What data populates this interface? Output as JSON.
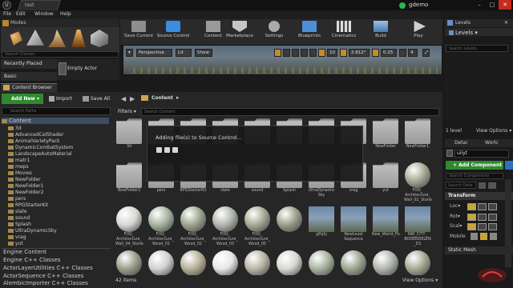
{
  "window": {
    "tab_title": "test",
    "project": "gdemo"
  },
  "menu": [
    "File",
    "Edit",
    "Window",
    "Help"
  ],
  "modes": {
    "title": "Modes",
    "search_placeholder": "Search Classes",
    "recently_placed": "Recently Placed",
    "basic": "Basic",
    "empty_actor": "Empty Actor"
  },
  "toolbar": {
    "buttons": [
      "Save Current",
      "Source Control",
      "Content",
      "Marketplace",
      "Settings",
      "Blueprints",
      "Cinematics",
      "Build",
      "Play"
    ]
  },
  "viewport": {
    "perspective": "Perspective",
    "lit": "Lit",
    "show": "Show",
    "grid_snap": "10",
    "rot_snap": "2.812°",
    "scale_snap": "0.25",
    "cam_speed": "4"
  },
  "levels": {
    "title": "Levels",
    "header": "Levels ▾",
    "search_placeholder": "Search Levels",
    "status": "1 level",
    "view_options": "View Options ▾"
  },
  "details": {
    "tabs": [
      "Detai",
      "Worlc"
    ],
    "actor_name": "uiiyt",
    "add_component": "+ Add Component ▾",
    "search_components": "Search Components",
    "search_details": "Search Deta",
    "transform": "Transform",
    "rows": [
      "Loc▾",
      "Rot▾",
      "Scal▾",
      "Mobile"
    ],
    "static_mesh": "Static Mesh"
  },
  "content_browser": {
    "tab": "Content Browser",
    "add_new": "Add New ▾",
    "import": "Import",
    "save_all": "Save All",
    "breadcrumb": "Content",
    "search_paths": "Search Paths",
    "filters": "Filters ▾",
    "search_assets": "Search Content",
    "tree_root": "Content",
    "tree": [
      "3d",
      "AdvancedCelShader",
      "AnimalVarietyPack",
      "DynamicCombatSystem",
      "LandscapeAutoMaterial",
      "matr1",
      "meps",
      "Movies",
      "NewFolder",
      "NewFolder1",
      "NewFolder2",
      "pers",
      "RPGStarterKit",
      "slate",
      "sound",
      "Splash",
      "UltraDynamicSky",
      "vrag",
      "yut"
    ],
    "categories": [
      "Engine Content",
      "Engine C++ Classes",
      "ActorLayerUtilities C++ Classes",
      "ActorSequence C++ Classes",
      "AlembicImporter C++ Classes"
    ],
    "row1": [
      "3d",
      "",
      "",
      "",
      "",
      "",
      "",
      "",
      "NewFolder",
      "NewFolder1"
    ],
    "row2": [
      "NewFolder2",
      "pers",
      "RPGStarterKit",
      "slate",
      "sound",
      "Splash",
      "UltraDynamic Sky",
      "vrag",
      "yut",
      "FOG_ Architecture_ Wall_02_Stone"
    ],
    "row3": [
      "FOG_ Architecture_ Wall_04_Stone",
      "FOG_ Architecture_ Wood_01",
      "FOG_ Architecture_ Wood_02",
      "FOG_ Architecture_ Wood_03",
      "FOG_ Architecture_ Wood_05",
      "",
      "gfhjhj",
      "NewLevel Sequence",
      "New_World_Po",
      "NW_CITY_ BODENDELEN _D1"
    ],
    "status": "42 items",
    "view_options": "View Options ▾"
  },
  "dialog": {
    "message": "Adding file(s) to Source Control..."
  }
}
